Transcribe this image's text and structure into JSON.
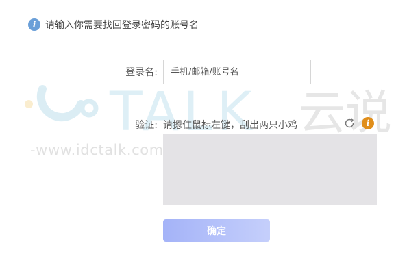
{
  "notice": {
    "icon": "info-icon",
    "text": "请输入你需要找回登录密码的账号名"
  },
  "form": {
    "login_label": "登录名:",
    "login_placeholder": "手机/邮箱/账号名",
    "login_value": "",
    "verify_label": "验证:",
    "verify_hint": "请摁住鼠标左键，刮出两只小鸡",
    "refresh_icon": "refresh-icon",
    "help_icon": "warning-icon",
    "captcha_color": "#e4e3e6"
  },
  "confirm_button": {
    "label": "确定"
  },
  "watermark": {
    "logo_text": "TALK",
    "cn_text": "云说",
    "url_line": "-www.idctalk.com-国内专业云计算交流服务平台-"
  },
  "colors": {
    "info": "#6a9fd8",
    "warning": "#e08e1b",
    "button_start": "#a4b3f8",
    "button_end": "#c5cffb"
  }
}
